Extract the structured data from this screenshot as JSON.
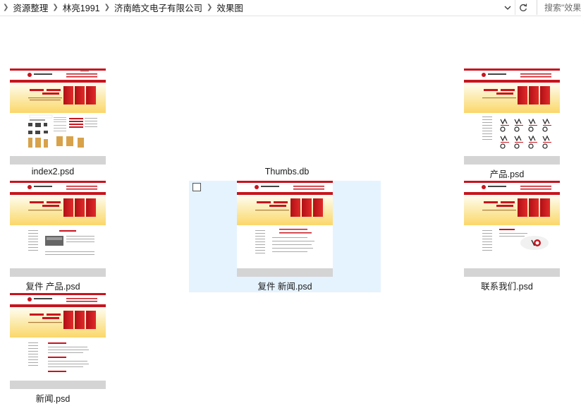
{
  "breadcrumb": {
    "items": [
      "资源整理",
      "林亮1991",
      "济南皓文电子有限公司",
      "效果图"
    ]
  },
  "search": {
    "placeholder": "搜索\"效果图\""
  },
  "files": [
    {
      "name": "index2.psd",
      "kind": "psd",
      "variant": "index"
    },
    {
      "name": "Thumbs.db",
      "kind": "db"
    },
    {
      "name": "产品.psd",
      "kind": "psd",
      "variant": "product"
    },
    {
      "name": "复件 产品.psd",
      "kind": "psd",
      "variant": "product2"
    },
    {
      "name": "复件 新闻.psd",
      "kind": "psd",
      "variant": "news",
      "selected": true
    },
    {
      "name": "联系我们.psd",
      "kind": "psd",
      "variant": "contact"
    },
    {
      "name": "新闻.psd",
      "kind": "psd",
      "variant": "newslist"
    }
  ],
  "colors": {
    "selection": "#e5f3ff",
    "thumb_red": "#c8141e",
    "banner_yellow": "#fde89a"
  }
}
